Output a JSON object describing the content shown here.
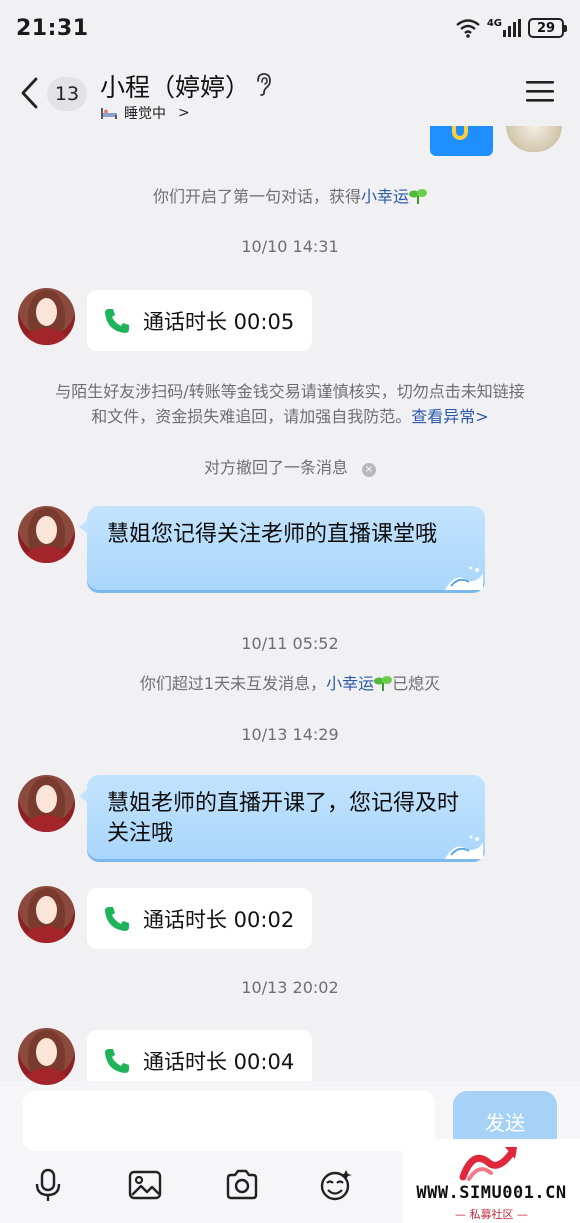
{
  "status_bar": {
    "time": "21:31",
    "network": "4G",
    "battery": "29"
  },
  "header": {
    "unread_count": "13",
    "contact_name": "小程（婷婷）",
    "status_text": "睡觉中",
    "status_chevron": ">"
  },
  "messages": {
    "first_chat_prefix": "你们开启了第一句对话，获得",
    "first_chat_link": "小幸运",
    "time_1": "10/10 14:31",
    "call_1": "通话时长 00:05",
    "warning_line1": "与陌生好友涉扫码/转账等金钱交易请谨慎核实，切勿点击未知链接",
    "warning_line2_prefix": "和文件，资金损失难追回，请加强自我防范。",
    "warning_link": "查看异常>",
    "recall_text": "对方撤回了一条消息",
    "recall_close": "×",
    "msg_1": "慧姐您记得关注老师的直播课堂哦",
    "time_2": "10/11 05:52",
    "extinguish_prefix": "你们超过1天未互发消息，",
    "extinguish_link": "小幸运",
    "extinguish_suffix": "已熄灭",
    "time_3": "10/13 14:29",
    "msg_2": "慧姐老师的直播开课了，您记得及时关注哦",
    "call_2": "通话时长 00:02",
    "time_4": "10/13 20:02",
    "call_3": "通话时长 00:04"
  },
  "input_bar": {
    "placeholder": "",
    "send_label": "发送"
  },
  "toolbar_icons": [
    "microphone-icon",
    "image-icon",
    "camera-icon",
    "sticker-icon"
  ],
  "watermark": {
    "text": "WWW.SIMU001.CN",
    "subtitle": "— 私募社区 —"
  },
  "colors": {
    "background": "#f1f1f4",
    "bubble": "#b6dcfd",
    "link": "#2d5aa8",
    "call_icon": "#1fb45a",
    "send": "#a7d2f7"
  }
}
